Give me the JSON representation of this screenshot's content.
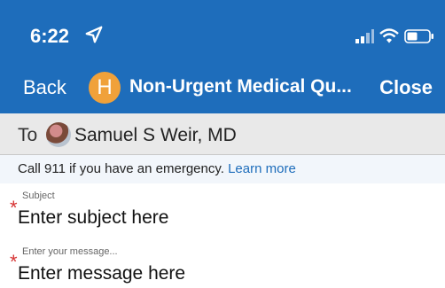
{
  "status_bar": {
    "time": "6:22"
  },
  "nav": {
    "back_label": "Back",
    "avatar_letter": "H",
    "title": "Non-Urgent Medical Qu...",
    "close_label": "Close"
  },
  "recipient": {
    "to_label": "To",
    "name": "Samuel S Weir, MD"
  },
  "notice": {
    "text": "Call 911 if you have an emergency.",
    "link": "Learn more"
  },
  "subject": {
    "label": "Subject",
    "placeholder": "Enter subject here",
    "required_mark": "*"
  },
  "message": {
    "label": "Enter your message...",
    "placeholder": "Enter message here",
    "required_mark": "*"
  },
  "colors": {
    "header_blue": "#1e6dbb",
    "avatar_orange": "#f0a13a",
    "required_red": "#d63333"
  },
  "icons": [
    "location-arrow-icon",
    "signal-icon",
    "wifi-icon",
    "battery-icon"
  ]
}
